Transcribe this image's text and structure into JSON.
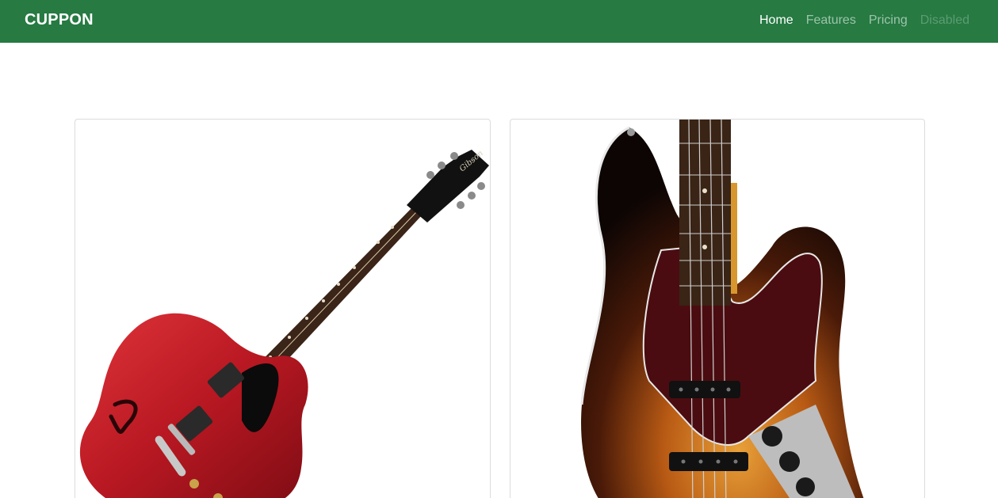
{
  "navbar": {
    "brand": "CUPPON",
    "links": [
      {
        "label": "Home",
        "state": "active"
      },
      {
        "label": "Features",
        "state": "normal"
      },
      {
        "label": "Pricing",
        "state": "normal"
      },
      {
        "label": "Disabled",
        "state": "disabled"
      }
    ],
    "background_color": "#267a42"
  },
  "products": [
    {
      "image": "red-semi-hollow-electric-guitar",
      "headstock_text": "Gibson"
    },
    {
      "image": "sunburst-electric-bass-guitar"
    }
  ]
}
